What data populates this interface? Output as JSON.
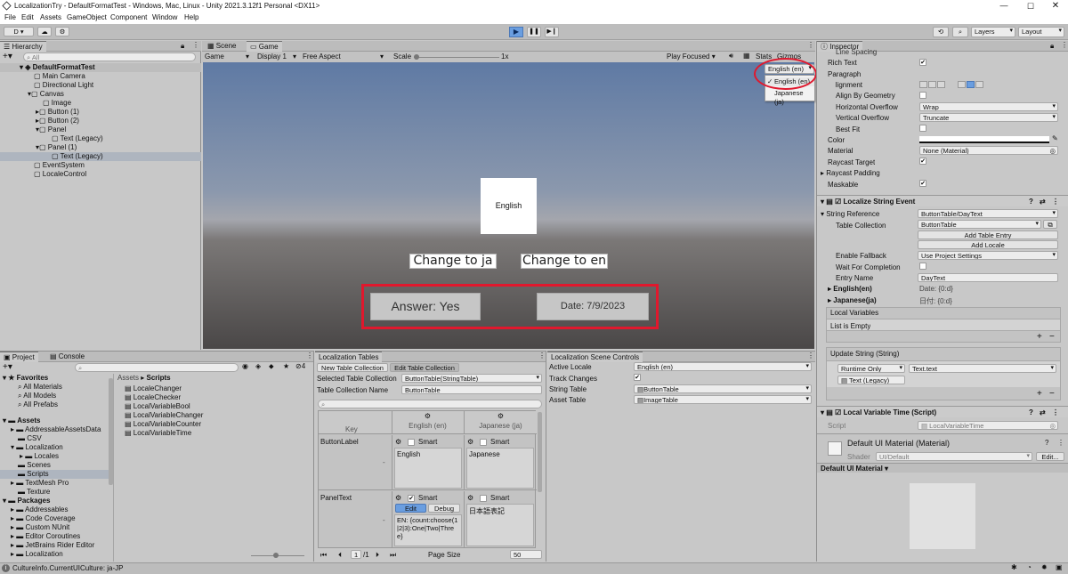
{
  "window": {
    "title": "LocalizationTry - DefaultFormatTest - Windows, Mac, Linux - Unity 2021.3.12f1 Personal <DX11>",
    "menu": [
      "File",
      "Edit",
      "Assets",
      "GameObject",
      "Component",
      "Window",
      "Help"
    ]
  },
  "toolbar": {
    "account": "D",
    "layers": "Layers",
    "layout": "Layout"
  },
  "hierarchy": {
    "tab": "Hierarchy",
    "search_placeholder": "All",
    "items": [
      "DefaultFormatTest",
      "Main Camera",
      "Directional Light",
      "Canvas",
      "Image",
      "Button (1)",
      "Button (2)",
      "Panel",
      "Text (Legacy)",
      "Panel (1)",
      "Text (Legacy)",
      "EventSystem",
      "LocaleControl"
    ]
  },
  "game": {
    "tabs": [
      "Scene",
      "Game"
    ],
    "display_mode": "Game",
    "display": "Display 1",
    "aspect": "Free Aspect",
    "scale_label": "Scale",
    "scale_value": "1x",
    "play_focused": "Play Focused",
    "stats": "Stats",
    "gizmos": "Gizmos",
    "locale_dropdown": "English (en)",
    "locale_options": [
      "English (en)",
      "Japanese (ja)"
    ],
    "image_text": "English",
    "btn_ja": "Change to ja",
    "btn_en": "Change to en",
    "answer": "Answer: Yes",
    "date": "Date: 7/9/2023",
    "colors": {
      "annotation": "#e0182d",
      "sky": "#5f7aa4",
      "ground": "#4a4747"
    }
  },
  "inspector": {
    "tab": "Inspector",
    "rows": [
      {
        "label": "Line Spacing",
        "value": ""
      },
      {
        "label": "Rich Text",
        "value": "✔"
      },
      {
        "label": "Paragraph",
        "value": ""
      },
      {
        "label": "Alignment",
        "value": ""
      },
      {
        "label": "Align By Geometry",
        "value": ""
      },
      {
        "label": "Horizontal Overflow",
        "value": "Wrap"
      },
      {
        "label": "Vertical Overflow",
        "value": "Truncate"
      },
      {
        "label": "Best Fit",
        "value": ""
      },
      {
        "label": "Color",
        "value": ""
      },
      {
        "label": "Material",
        "value": "None (Material)"
      },
      {
        "label": "Raycast Target",
        "value": "✔"
      },
      {
        "label": "Raycast Padding",
        "value": ""
      },
      {
        "label": "Maskable",
        "value": "✔"
      }
    ],
    "lse": {
      "title": "Localize String Event",
      "string_reference": "String Reference",
      "string_reference_value": "ButtonTable/DayText",
      "table_collection": "Table Collection",
      "table_collection_value": "ButtonTable",
      "add_table_entry": "Add Table Entry",
      "add_locale": "Add Locale",
      "enable_fallback": "Enable Fallback",
      "enable_fallback_value": "Use Project Settings",
      "wait_for_completion": "Wait For Completion",
      "entry_name": "Entry Name",
      "entry_name_value": "DayText",
      "en_label": "English(en)",
      "en_value": "Date: {0:d}",
      "ja_label": "Japanese(ja)",
      "ja_value": "日付: {0:d}",
      "local_variables": "Local Variables",
      "list_empty": "List is Empty",
      "update_string": "Update String (String)",
      "runtime_only": "Runtime Only",
      "text_text": "Text.text",
      "text_legacy": "Text (Legacy)"
    },
    "lvt": {
      "title": "Local Variable Time (Script)",
      "script_label": "Script",
      "script_value": "LocalVariableTime"
    },
    "material": {
      "title": "Default UI Material (Material)",
      "shader_label": "Shader",
      "shader_value": "UI/Default",
      "edit": "Edit...",
      "preview_label": "Default UI Material"
    }
  },
  "project": {
    "tabs": [
      "Project",
      "Console"
    ],
    "breadcrumb_root": "Assets",
    "breadcrumb_current": "Scripts",
    "tree": [
      {
        "label": "Favorites",
        "bold": true
      },
      {
        "label": "All Materials"
      },
      {
        "label": "All Models"
      },
      {
        "label": "All Prefabs"
      },
      {
        "label": "Assets",
        "bold": true
      },
      {
        "label": "AddressableAssetsData"
      },
      {
        "label": "CSV"
      },
      {
        "label": "Localization"
      },
      {
        "label": "Locales"
      },
      {
        "label": "Scenes"
      },
      {
        "label": "Scripts"
      },
      {
        "label": "TextMesh Pro"
      },
      {
        "label": "Texture"
      },
      {
        "label": "Packages",
        "bold": true
      },
      {
        "label": "Addressables"
      },
      {
        "label": "Code Coverage"
      },
      {
        "label": "Custom NUnit"
      },
      {
        "label": "Editor Coroutines"
      },
      {
        "label": "JetBrains Rider Editor"
      },
      {
        "label": "Localization"
      }
    ],
    "files": [
      "LocaleChanger",
      "LocaleChecker",
      "LocalVariableBool",
      "LocalVariableChanger",
      "LocalVariableCounter",
      "LocalVariableTime"
    ],
    "hidden_count": "4"
  },
  "tables": {
    "tab": "Localization Tables",
    "new_collection": "New Table Collection",
    "edit_collection": "Edit Table Collection",
    "selected_label": "Selected Table Collection",
    "selected_value": "ButtonTable(StringTable)",
    "name_label": "Table Collection Name",
    "name_value": "ButtonTable",
    "key_header": "Key",
    "col_en": "English (en)",
    "col_ja": "Japanese (ja)",
    "smart": "Smart",
    "rows": [
      {
        "key": "ButtonLabel",
        "en": "English",
        "ja": "Japanese"
      },
      {
        "key": "PanelText",
        "en": "EN: {count:choose(1|2|3):One|Two|Three}",
        "ja": "日本語表記"
      }
    ],
    "edit_btn": "Edit",
    "debug_btn": "Debug",
    "page": "1",
    "page_total": "/1",
    "page_size_label": "Page Size",
    "page_size": "50"
  },
  "scene_controls": {
    "tab": "Localization Scene Controls",
    "active_locale_label": "Active Locale",
    "active_locale": "English (en)",
    "track_changes_label": "Track Changes",
    "string_table_label": "String Table",
    "string_table": "ButtonTable",
    "asset_table_label": "Asset Table",
    "asset_table": "ImageTable"
  },
  "status": {
    "text": "CultureInfo.CurrentUICulture: ja-JP"
  }
}
